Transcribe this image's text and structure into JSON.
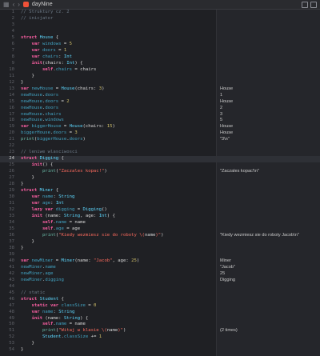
{
  "window": {
    "filename": "dayNine",
    "nav_back": "‹",
    "nav_forward": "›"
  },
  "lines": [
    {
      "n": "1",
      "tokens": [
        {
          "t": "// Struktury cz. 2",
          "c": "cmt"
        }
      ],
      "result": ""
    },
    {
      "n": "2",
      "tokens": [
        {
          "t": "// inicjator",
          "c": "cmt"
        }
      ],
      "result": ""
    },
    {
      "n": "3",
      "tokens": [],
      "result": ""
    },
    {
      "n": "4",
      "tokens": [],
      "result": ""
    },
    {
      "n": "5",
      "tokens": [
        {
          "t": "struct ",
          "c": "kw"
        },
        {
          "t": "House",
          "c": "type"
        },
        {
          "t": " {",
          "c": "plain"
        }
      ],
      "result": ""
    },
    {
      "n": "6",
      "tokens": [
        {
          "t": "    var ",
          "c": "kw"
        },
        {
          "t": "windows",
          "c": "id"
        },
        {
          "t": " = ",
          "c": "plain"
        },
        {
          "t": "5",
          "c": "num"
        }
      ],
      "result": ""
    },
    {
      "n": "7",
      "tokens": [
        {
          "t": "    var ",
          "c": "kw"
        },
        {
          "t": "doors",
          "c": "id"
        },
        {
          "t": " = ",
          "c": "plain"
        },
        {
          "t": "1",
          "c": "num"
        }
      ],
      "result": ""
    },
    {
      "n": "8",
      "tokens": [
        {
          "t": "    var ",
          "c": "kw"
        },
        {
          "t": "chairs",
          "c": "id"
        },
        {
          "t": ": ",
          "c": "plain"
        },
        {
          "t": "Int",
          "c": "type"
        }
      ],
      "result": ""
    },
    {
      "n": "9",
      "tokens": [
        {
          "t": "    init",
          "c": "kw"
        },
        {
          "t": "(chairs: ",
          "c": "plain"
        },
        {
          "t": "Int",
          "c": "type"
        },
        {
          "t": ") {",
          "c": "plain"
        }
      ],
      "result": ""
    },
    {
      "n": "10",
      "tokens": [
        {
          "t": "        self",
          "c": "kw"
        },
        {
          "t": ".",
          "c": "plain"
        },
        {
          "t": "chairs",
          "c": "id"
        },
        {
          "t": " = chairs",
          "c": "plain"
        }
      ],
      "result": ""
    },
    {
      "n": "11",
      "tokens": [
        {
          "t": "    }",
          "c": "plain"
        }
      ],
      "result": ""
    },
    {
      "n": "12",
      "tokens": [
        {
          "t": "}",
          "c": "plain"
        }
      ],
      "result": ""
    },
    {
      "n": "13",
      "tokens": [
        {
          "t": "var ",
          "c": "kw"
        },
        {
          "t": "newHouse",
          "c": "id"
        },
        {
          "t": " = ",
          "c": "plain"
        },
        {
          "t": "House",
          "c": "type"
        },
        {
          "t": "(chairs: ",
          "c": "plain"
        },
        {
          "t": "3",
          "c": "num"
        },
        {
          "t": ")",
          "c": "plain"
        }
      ],
      "result": "House"
    },
    {
      "n": "14",
      "tokens": [
        {
          "t": "newHouse",
          "c": "id"
        },
        {
          "t": ".",
          "c": "plain"
        },
        {
          "t": "doors",
          "c": "id"
        }
      ],
      "result": "1"
    },
    {
      "n": "15",
      "tokens": [
        {
          "t": "newHouse",
          "c": "id"
        },
        {
          "t": ".",
          "c": "plain"
        },
        {
          "t": "doors",
          "c": "id"
        },
        {
          "t": " = ",
          "c": "plain"
        },
        {
          "t": "2",
          "c": "num"
        }
      ],
      "result": "House"
    },
    {
      "n": "16",
      "tokens": [
        {
          "t": "newHouse",
          "c": "id"
        },
        {
          "t": ".",
          "c": "plain"
        },
        {
          "t": "doors",
          "c": "id"
        }
      ],
      "result": "2"
    },
    {
      "n": "17",
      "tokens": [
        {
          "t": "newHouse",
          "c": "id"
        },
        {
          "t": ".",
          "c": "plain"
        },
        {
          "t": "chairs",
          "c": "id"
        }
      ],
      "result": "3"
    },
    {
      "n": "18",
      "tokens": [
        {
          "t": "newHouse",
          "c": "id"
        },
        {
          "t": ".",
          "c": "plain"
        },
        {
          "t": "windows",
          "c": "id"
        }
      ],
      "result": "5"
    },
    {
      "n": "19",
      "tokens": [
        {
          "t": "var ",
          "c": "kw"
        },
        {
          "t": "biggerHouse",
          "c": "id"
        },
        {
          "t": " = ",
          "c": "plain"
        },
        {
          "t": "House",
          "c": "type"
        },
        {
          "t": "(chairs: ",
          "c": "plain"
        },
        {
          "t": "15",
          "c": "num"
        },
        {
          "t": ")",
          "c": "plain"
        }
      ],
      "result": "House"
    },
    {
      "n": "20",
      "tokens": [
        {
          "t": "biggerHouse",
          "c": "id"
        },
        {
          "t": ".",
          "c": "plain"
        },
        {
          "t": "doors",
          "c": "id"
        },
        {
          "t": " = ",
          "c": "plain"
        },
        {
          "t": "3",
          "c": "num"
        }
      ],
      "result": "House"
    },
    {
      "n": "21",
      "tokens": [
        {
          "t": "print",
          "c": "fn"
        },
        {
          "t": "(",
          "c": "plain"
        },
        {
          "t": "biggerHouse",
          "c": "id"
        },
        {
          "t": ".",
          "c": "plain"
        },
        {
          "t": "doors",
          "c": "id"
        },
        {
          "t": ")",
          "c": "plain"
        }
      ],
      "result": "\"3\\n\""
    },
    {
      "n": "22",
      "tokens": [],
      "result": ""
    },
    {
      "n": "23",
      "tokens": [
        {
          "t": "// leniwe wlasciwosci",
          "c": "cmt"
        }
      ],
      "result": ""
    },
    {
      "n": "24",
      "active": true,
      "tokens": [
        {
          "t": "struct ",
          "c": "kw"
        },
        {
          "t": "Digging",
          "c": "type"
        },
        {
          "t": " {",
          "c": "plain"
        }
      ],
      "result": ""
    },
    {
      "n": "25",
      "tokens": [
        {
          "t": "    init",
          "c": "kw"
        },
        {
          "t": "() {",
          "c": "plain"
        }
      ],
      "result": ""
    },
    {
      "n": "26",
      "tokens": [
        {
          "t": "        print",
          "c": "fn"
        },
        {
          "t": "(",
          "c": "plain"
        },
        {
          "t": "\"Zaczales kopac!\"",
          "c": "str"
        },
        {
          "t": ")",
          "c": "plain"
        }
      ],
      "result": "\"Zaczales kopac!\\n\""
    },
    {
      "n": "27",
      "tokens": [
        {
          "t": "    }",
          "c": "plain"
        }
      ],
      "result": ""
    },
    {
      "n": "28",
      "tokens": [
        {
          "t": "}",
          "c": "plain"
        }
      ],
      "result": ""
    },
    {
      "n": "29",
      "tokens": [
        {
          "t": "struct ",
          "c": "kw"
        },
        {
          "t": "Miner",
          "c": "type"
        },
        {
          "t": " {",
          "c": "plain"
        }
      ],
      "result": ""
    },
    {
      "n": "30",
      "tokens": [
        {
          "t": "    var ",
          "c": "kw"
        },
        {
          "t": "name",
          "c": "id"
        },
        {
          "t": ": ",
          "c": "plain"
        },
        {
          "t": "String",
          "c": "type"
        }
      ],
      "result": ""
    },
    {
      "n": "31",
      "tokens": [
        {
          "t": "    var ",
          "c": "kw"
        },
        {
          "t": "age",
          "c": "id"
        },
        {
          "t": ": ",
          "c": "plain"
        },
        {
          "t": "Int",
          "c": "type"
        }
      ],
      "result": ""
    },
    {
      "n": "32",
      "tokens": [
        {
          "t": "    lazy var ",
          "c": "kw"
        },
        {
          "t": "digging",
          "c": "id"
        },
        {
          "t": " = ",
          "c": "plain"
        },
        {
          "t": "Digging",
          "c": "type"
        },
        {
          "t": "()",
          "c": "plain"
        }
      ],
      "result": ""
    },
    {
      "n": "33",
      "tokens": [
        {
          "t": "    init ",
          "c": "kw"
        },
        {
          "t": "(name: ",
          "c": "plain"
        },
        {
          "t": "String",
          "c": "type"
        },
        {
          "t": ", age: ",
          "c": "plain"
        },
        {
          "t": "Int",
          "c": "type"
        },
        {
          "t": ") {",
          "c": "plain"
        }
      ],
      "result": ""
    },
    {
      "n": "34",
      "tokens": [
        {
          "t": "        self",
          "c": "kw"
        },
        {
          "t": ".",
          "c": "plain"
        },
        {
          "t": "name",
          "c": "id"
        },
        {
          "t": " = name",
          "c": "plain"
        }
      ],
      "result": ""
    },
    {
      "n": "35",
      "tokens": [
        {
          "t": "        self",
          "c": "kw"
        },
        {
          "t": ".",
          "c": "plain"
        },
        {
          "t": "age",
          "c": "id"
        },
        {
          "t": " = age",
          "c": "plain"
        }
      ],
      "result": ""
    },
    {
      "n": "36",
      "tokens": [
        {
          "t": "        print",
          "c": "fn"
        },
        {
          "t": "(",
          "c": "plain"
        },
        {
          "t": "\"Kiedy wezmiesz sie do roboty \\(",
          "c": "str"
        },
        {
          "t": "name",
          "c": "plain"
        },
        {
          "t": ")\"",
          "c": "str"
        },
        {
          "t": ")",
          "c": "plain"
        }
      ],
      "result": "\"Kiedy wezmiesz sie do roboty Jacob\\n\""
    },
    {
      "n": "37",
      "tokens": [
        {
          "t": "    }",
          "c": "plain"
        }
      ],
      "result": ""
    },
    {
      "n": "38",
      "tokens": [
        {
          "t": "}",
          "c": "plain"
        }
      ],
      "result": ""
    },
    {
      "n": "39",
      "tokens": [],
      "result": ""
    },
    {
      "n": "40",
      "tokens": [
        {
          "t": "var ",
          "c": "kw"
        },
        {
          "t": "newMiner",
          "c": "id"
        },
        {
          "t": " = ",
          "c": "plain"
        },
        {
          "t": "Miner",
          "c": "type"
        },
        {
          "t": "(name: ",
          "c": "plain"
        },
        {
          "t": "\"Jacob\"",
          "c": "str"
        },
        {
          "t": ", age: ",
          "c": "plain"
        },
        {
          "t": "25",
          "c": "num"
        },
        {
          "t": ")",
          "c": "plain"
        }
      ],
      "result": "Miner"
    },
    {
      "n": "41",
      "tokens": [
        {
          "t": "newMiner",
          "c": "id"
        },
        {
          "t": ".",
          "c": "plain"
        },
        {
          "t": "name",
          "c": "id"
        }
      ],
      "result": "\"Jacob\""
    },
    {
      "n": "42",
      "tokens": [
        {
          "t": "newMiner",
          "c": "id"
        },
        {
          "t": ".",
          "c": "plain"
        },
        {
          "t": "age",
          "c": "id"
        }
      ],
      "result": "25"
    },
    {
      "n": "43",
      "tokens": [
        {
          "t": "newMiner",
          "c": "id"
        },
        {
          "t": ".",
          "c": "plain"
        },
        {
          "t": "digging",
          "c": "id"
        }
      ],
      "result": "Digging"
    },
    {
      "n": "44",
      "tokens": [],
      "result": ""
    },
    {
      "n": "45",
      "tokens": [
        {
          "t": "// static",
          "c": "cmt"
        }
      ],
      "result": ""
    },
    {
      "n": "46",
      "tokens": [
        {
          "t": "struct ",
          "c": "kw"
        },
        {
          "t": "Student",
          "c": "type"
        },
        {
          "t": " {",
          "c": "plain"
        }
      ],
      "result": ""
    },
    {
      "n": "47",
      "tokens": [
        {
          "t": "    static var ",
          "c": "kw"
        },
        {
          "t": "classSize",
          "c": "id"
        },
        {
          "t": " = ",
          "c": "plain"
        },
        {
          "t": "0",
          "c": "num"
        }
      ],
      "result": ""
    },
    {
      "n": "48",
      "tokens": [
        {
          "t": "    var ",
          "c": "kw"
        },
        {
          "t": "name",
          "c": "id"
        },
        {
          "t": ": ",
          "c": "plain"
        },
        {
          "t": "String",
          "c": "type"
        }
      ],
      "result": ""
    },
    {
      "n": "49",
      "tokens": [
        {
          "t": "    init ",
          "c": "kw"
        },
        {
          "t": "(name: ",
          "c": "plain"
        },
        {
          "t": "String",
          "c": "type"
        },
        {
          "t": ") {",
          "c": "plain"
        }
      ],
      "result": ""
    },
    {
      "n": "50",
      "tokens": [
        {
          "t": "        self",
          "c": "kw"
        },
        {
          "t": ".",
          "c": "plain"
        },
        {
          "t": "name",
          "c": "id"
        },
        {
          "t": " = name",
          "c": "plain"
        }
      ],
      "result": ""
    },
    {
      "n": "51",
      "tokens": [
        {
          "t": "        print",
          "c": "fn"
        },
        {
          "t": "(",
          "c": "plain"
        },
        {
          "t": "\"Witaj w klasie \\(",
          "c": "str"
        },
        {
          "t": "name",
          "c": "plain"
        },
        {
          "t": ")\"",
          "c": "str"
        },
        {
          "t": ")",
          "c": "plain"
        }
      ],
      "result": "(2 times)"
    },
    {
      "n": "52",
      "tokens": [
        {
          "t": "        Student",
          "c": "type"
        },
        {
          "t": ".",
          "c": "plain"
        },
        {
          "t": "classSize",
          "c": "id"
        },
        {
          "t": " += ",
          "c": "plain"
        },
        {
          "t": "1",
          "c": "num"
        }
      ],
      "result": ""
    },
    {
      "n": "53",
      "tokens": [
        {
          "t": "    }",
          "c": "plain"
        }
      ],
      "result": ""
    },
    {
      "n": "54",
      "tokens": [
        {
          "t": "}",
          "c": "plain"
        }
      ],
      "result": ""
    }
  ]
}
